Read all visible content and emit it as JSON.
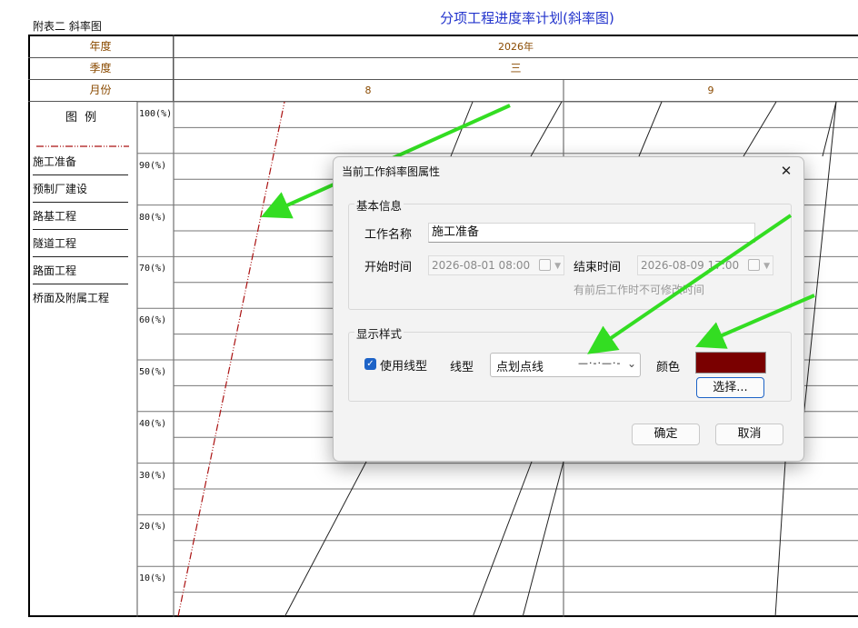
{
  "sheet": {
    "caption": "附表二  斜率图",
    "title": "分项工程进度率计划(斜率图)",
    "header": {
      "year_label": "年度",
      "year_value": "2026年",
      "quarter_label": "季度",
      "quarter_value": "三",
      "month_label": "月份",
      "month_8": "8",
      "month_9": "9"
    },
    "legend": {
      "title": "图   例",
      "items": [
        "施工准备",
        "预制厂建设",
        "路基工程",
        "隧道工程",
        "路面工程",
        "桥面及附属工程"
      ]
    },
    "y_ticks": [
      "100(%)",
      "90(%)",
      "80(%)",
      "70(%)",
      "60(%)",
      "50(%)",
      "40(%)",
      "30(%)",
      "20(%)",
      "10(%)"
    ]
  },
  "dialog": {
    "title": "当前工作斜率图属性",
    "close_icon": "close-icon",
    "basic_group": {
      "title": "基本信息",
      "name_label": "工作名称",
      "name_value": "施工准备",
      "start_label": "开始时间",
      "start_value": "2026-08-01 08:00",
      "end_label": "结束时间",
      "end_value": "2026-08-09 17:00",
      "hint": "有前后工作时不可修改时间"
    },
    "style_group": {
      "title": "显示样式",
      "use_linetype_checked": true,
      "use_linetype_label": "使用线型",
      "linetype_label": "线型",
      "linetype_value": "点划点线",
      "linetype_preview": "—·-·—·-",
      "color_label": "颜色",
      "color_value": "#7a0000",
      "choose_button": "选择..."
    },
    "ok_button": "确定",
    "cancel_button": "取消"
  },
  "colors": {
    "accent": "#1d63c7",
    "arrow": "#33dd22",
    "dashline": "#aa1111",
    "title": "#2233cc"
  }
}
